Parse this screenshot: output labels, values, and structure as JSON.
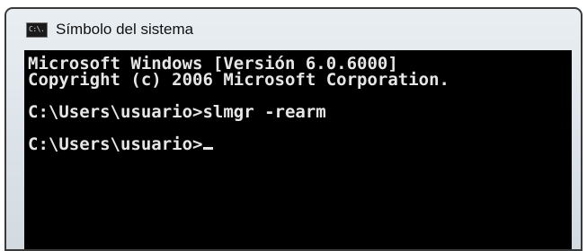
{
  "window": {
    "title": "Símbolo del sistema",
    "icon": "cmd-icon",
    "icon_text": "C:\\."
  },
  "console": {
    "lines": [
      "Microsoft Windows [Versión 6.0.6000]",
      "Copyright (c) 2006 Microsoft Corporation.",
      "",
      "C:\\Users\\usuario>slmgr -rearm",
      "",
      "C:\\Users\\usuario>"
    ]
  },
  "colors": {
    "console_bg": "#000000",
    "console_text": "#e6e6e6",
    "frame": "#d2dae0"
  }
}
